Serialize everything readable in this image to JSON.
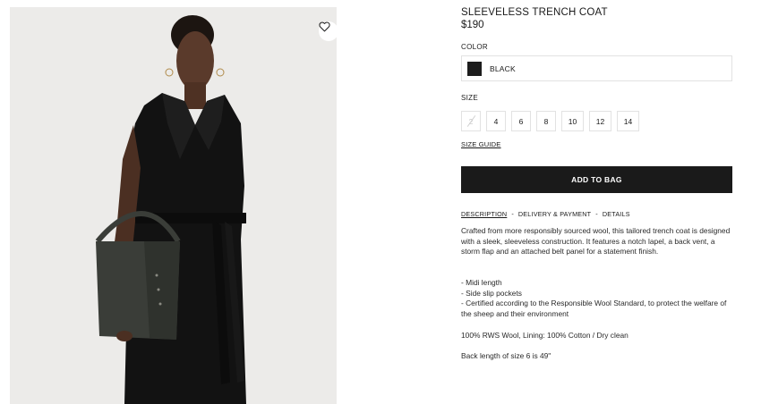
{
  "product": {
    "title": "SLEEVELESS TRENCH COAT",
    "price": "$190"
  },
  "color": {
    "label": "COLOR",
    "selected": "BLACK",
    "swatch_hex": "#1d1d1d"
  },
  "size": {
    "label": "SIZE",
    "options": [
      "2",
      "4",
      "6",
      "8",
      "10",
      "12",
      "14"
    ],
    "unavailable": [
      "2"
    ],
    "guide_label": "SIZE GUIDE"
  },
  "cart": {
    "add_label": "ADD TO BAG"
  },
  "tabs": {
    "items": [
      "DESCRIPTION",
      "DELIVERY & PAYMENT",
      "DETAILS"
    ],
    "separator": "-",
    "active": "DESCRIPTION"
  },
  "description": {
    "text": "Crafted from more responsibly sourced wool, this tailored trench coat is designed with a sleek, sleeveless construction. It features a notch lapel, a back vent, a storm flap and an attached belt panel for a statement finish.",
    "bullets": [
      "- Midi length",
      "- Side slip pockets",
      "- Certified according to the Responsible Wool Standard, to protect the welfare of the sheep and their environment"
    ],
    "composition": "100% RWS Wool, Lining: 100% Cotton / Dry clean",
    "back_length": "Back length of size 6 is 49\""
  },
  "icons": {
    "favorite": "heart-icon"
  },
  "colors": {
    "button_bg": "#1a1a1a",
    "photo_bg": "#ececea",
    "border": "#e2e2e2"
  }
}
